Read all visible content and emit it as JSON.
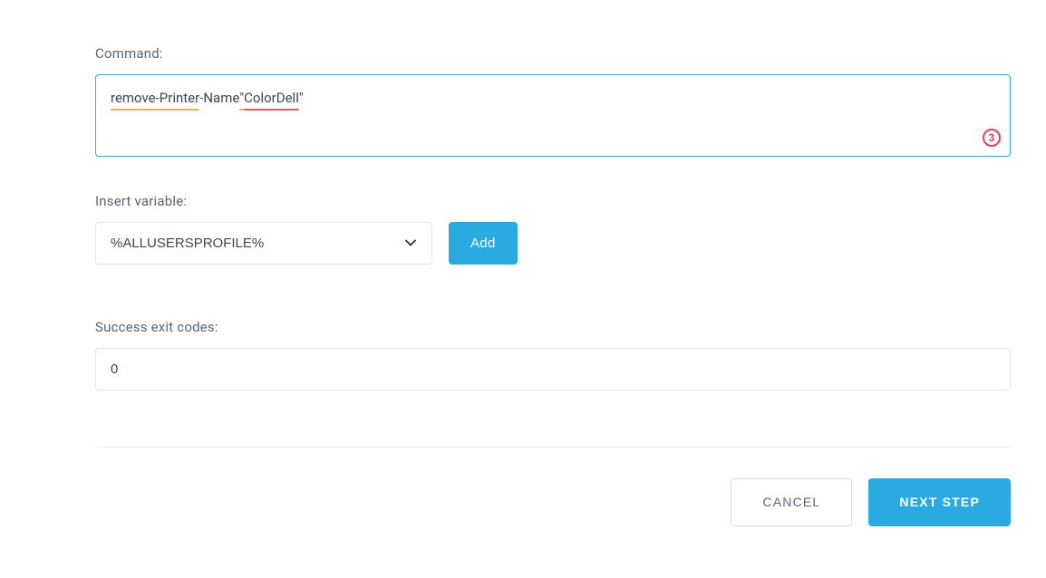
{
  "command": {
    "label": "Command:",
    "value_plain": "remove-Printer -Name \" ColorDell\"",
    "tokens": {
      "t1": "remove-Printer",
      "t2": " -Name ",
      "t3": "\"",
      "t4": " ColorDell",
      "t5": "\""
    },
    "step_badge": "3"
  },
  "insert_variable": {
    "label": "Insert variable:",
    "selected": "%ALLUSERSPROFILE%",
    "add_button": "Add"
  },
  "exit_codes": {
    "label": "Success exit codes:",
    "value": "0"
  },
  "footer": {
    "cancel": "CANCEL",
    "next": "NEXT STEP"
  }
}
